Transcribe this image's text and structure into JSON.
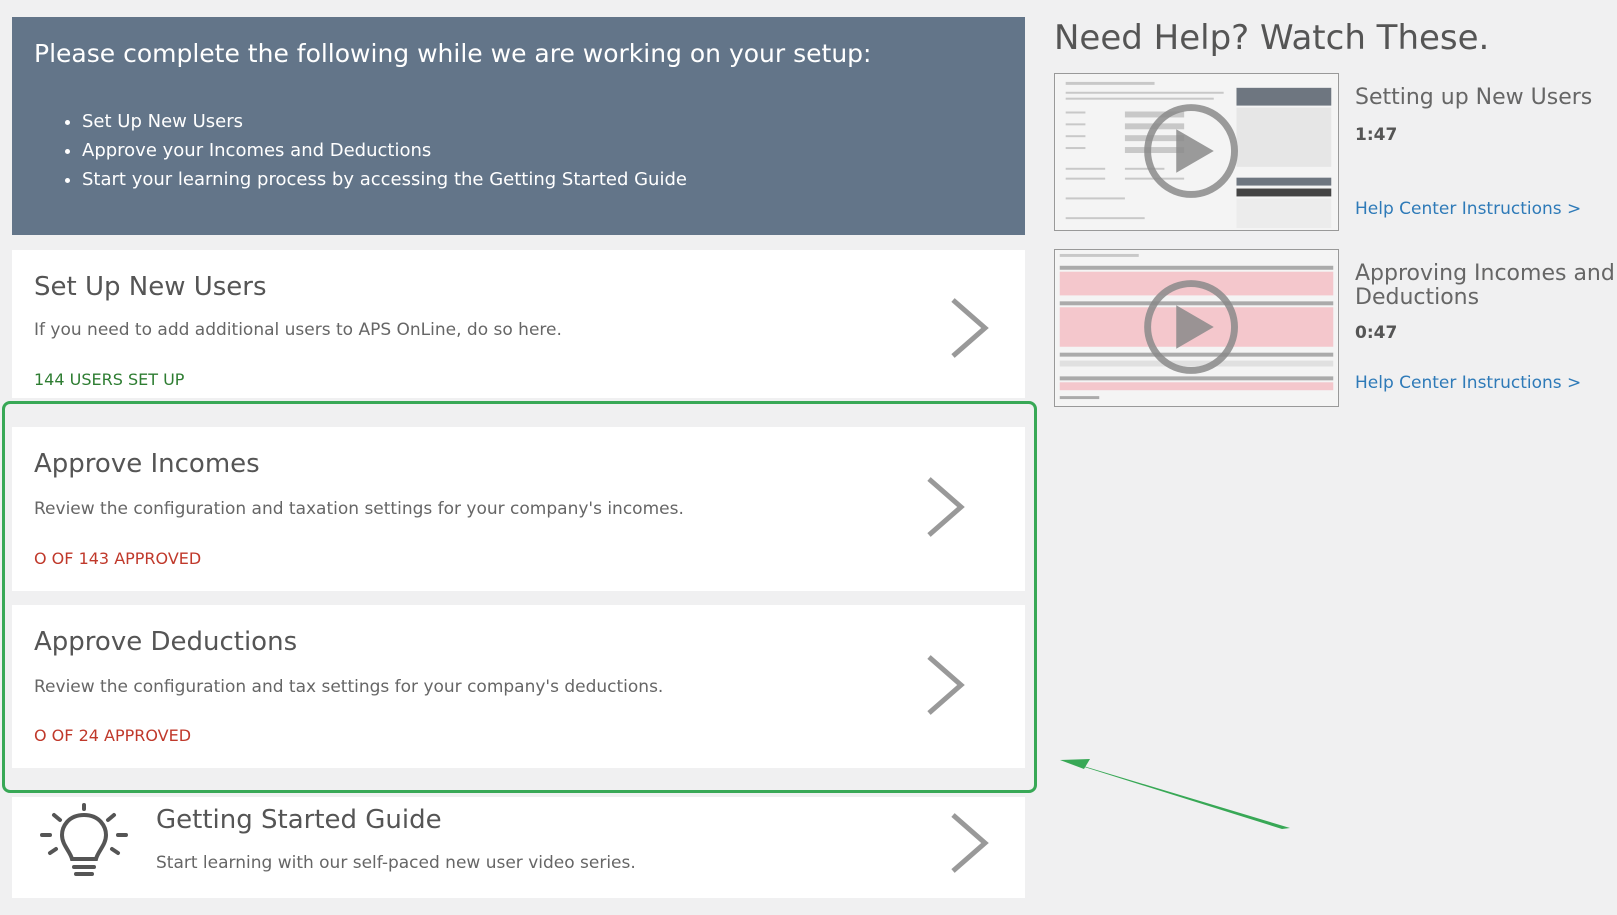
{
  "banner": {
    "heading": "Please complete the following while we are working on your setup:",
    "items": [
      "Set Up New Users",
      "Approve your Incomes and Deductions",
      "Start your learning process by accessing the Getting Started Guide"
    ]
  },
  "cards": {
    "users": {
      "title": "Set Up New Users",
      "description": "If you need to add additional users to APS OnLine, do so here.",
      "status": "144 USERS SET UP"
    },
    "incomes": {
      "title": "Approve Incomes",
      "description": "Review the configuration and taxation settings for your company's incomes.",
      "status": "O OF 143 APPROVED"
    },
    "deductions": {
      "title": "Approve Deductions",
      "description": "Review the configuration and tax settings for your company's deductions.",
      "status": "O OF 24 APPROVED"
    },
    "guide": {
      "title": "Getting Started Guide",
      "description": "Start learning with our self-paced new user video series."
    }
  },
  "help": {
    "heading": "Need Help? Watch These.",
    "videos": [
      {
        "title": "Setting up New Users",
        "duration": "1:47",
        "link": "Help Center Instructions >"
      },
      {
        "title": "Approving Incomes and Deductions",
        "duration": "0:47",
        "link": "Help Center Instructions >"
      }
    ]
  },
  "colors": {
    "banner_bg": "#637589",
    "highlight": "#38a856",
    "status_green": "#2e7d32",
    "status_red": "#c0392b",
    "link": "#2e7ab8"
  },
  "icons": [
    "chevron-right-icon",
    "lightbulb-icon",
    "play-icon",
    "arrow-annotation"
  ]
}
